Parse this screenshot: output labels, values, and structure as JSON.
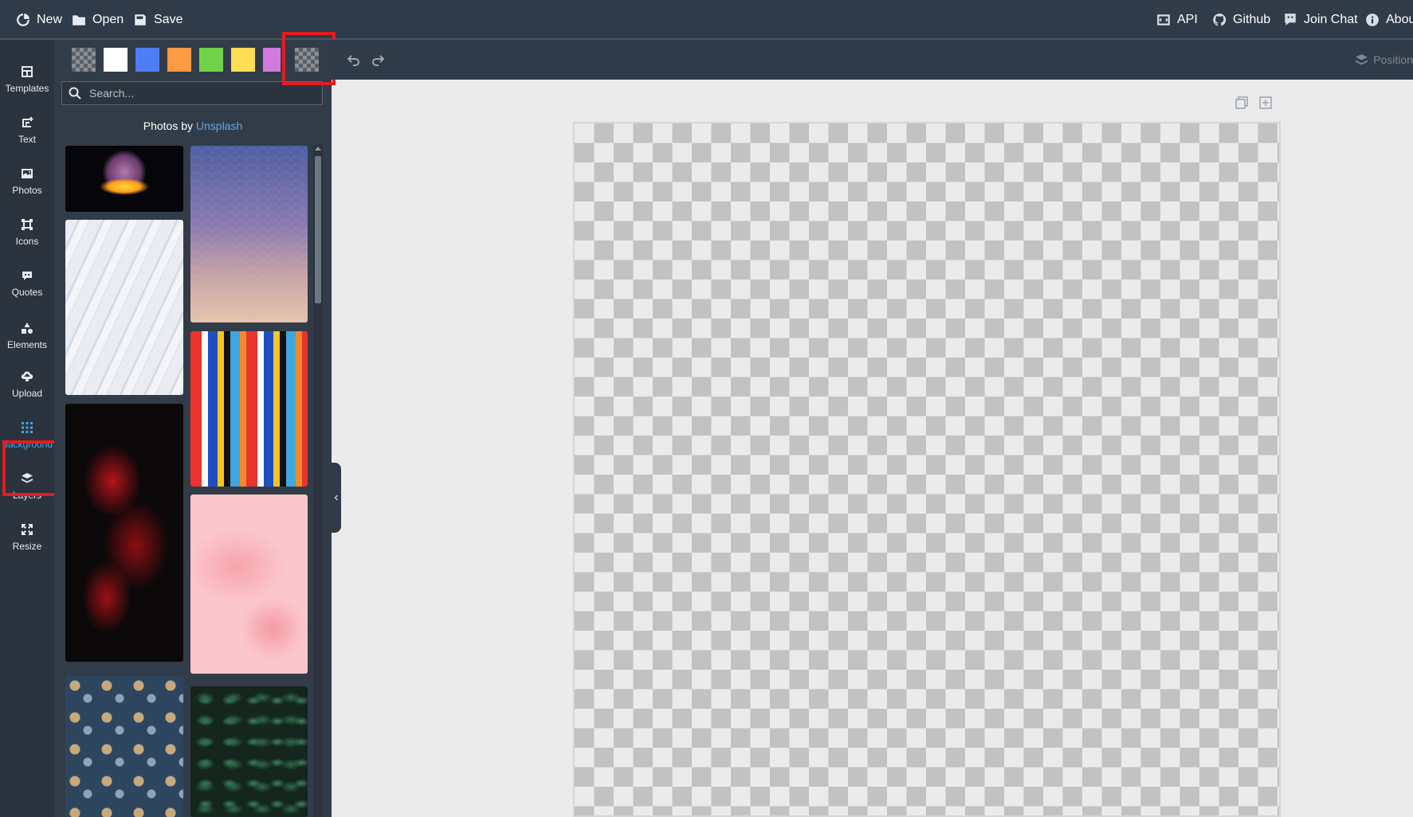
{
  "topbar": {
    "new_label": "New",
    "open_label": "Open",
    "save_label": "Save",
    "api_label": "API",
    "github_label": "Github",
    "chat_label": "Join Chat",
    "about_label": "About"
  },
  "nav": {
    "items": [
      {
        "label": "Templates",
        "icon": "templates-icon"
      },
      {
        "label": "Text",
        "icon": "text-icon"
      },
      {
        "label": "Photos",
        "icon": "photos-icon"
      },
      {
        "label": "Icons",
        "icon": "icons-icon"
      },
      {
        "label": "Quotes",
        "icon": "quotes-icon"
      },
      {
        "label": "Elements",
        "icon": "elements-icon"
      },
      {
        "label": "Upload",
        "icon": "upload-icon"
      },
      {
        "label": "Background",
        "icon": "background-icon"
      },
      {
        "label": "Layers",
        "icon": "layers-icon"
      },
      {
        "label": "Resize",
        "icon": "resize-icon"
      }
    ],
    "active": "Background"
  },
  "panel": {
    "swatches": [
      "transparent",
      "#ffffff",
      "#4f7df5",
      "#ff9a44",
      "#70d24a",
      "#ffdd55",
      "#d27adf",
      "transparent"
    ],
    "search_placeholder": "Search...",
    "credit_prefix": "Photos by",
    "credit_link": "Unsplash",
    "photos": [
      {
        "name": "hand-sculpture-photo"
      },
      {
        "name": "pastel-scale-pattern-photo"
      },
      {
        "name": "white-waves-photo"
      },
      {
        "name": "colorful-bricks-photo"
      },
      {
        "name": "red-fractal-photo"
      },
      {
        "name": "pink-marble-photo"
      },
      {
        "name": "floral-pattern-photo"
      },
      {
        "name": "green-leaves-photo"
      }
    ]
  },
  "toolbar": {
    "position_label": "Position"
  },
  "colors": {
    "accent": "#46a6e5",
    "highlight": "#e11d1d",
    "topbar": "#2f3b48",
    "sidebar": "#2a333e"
  }
}
